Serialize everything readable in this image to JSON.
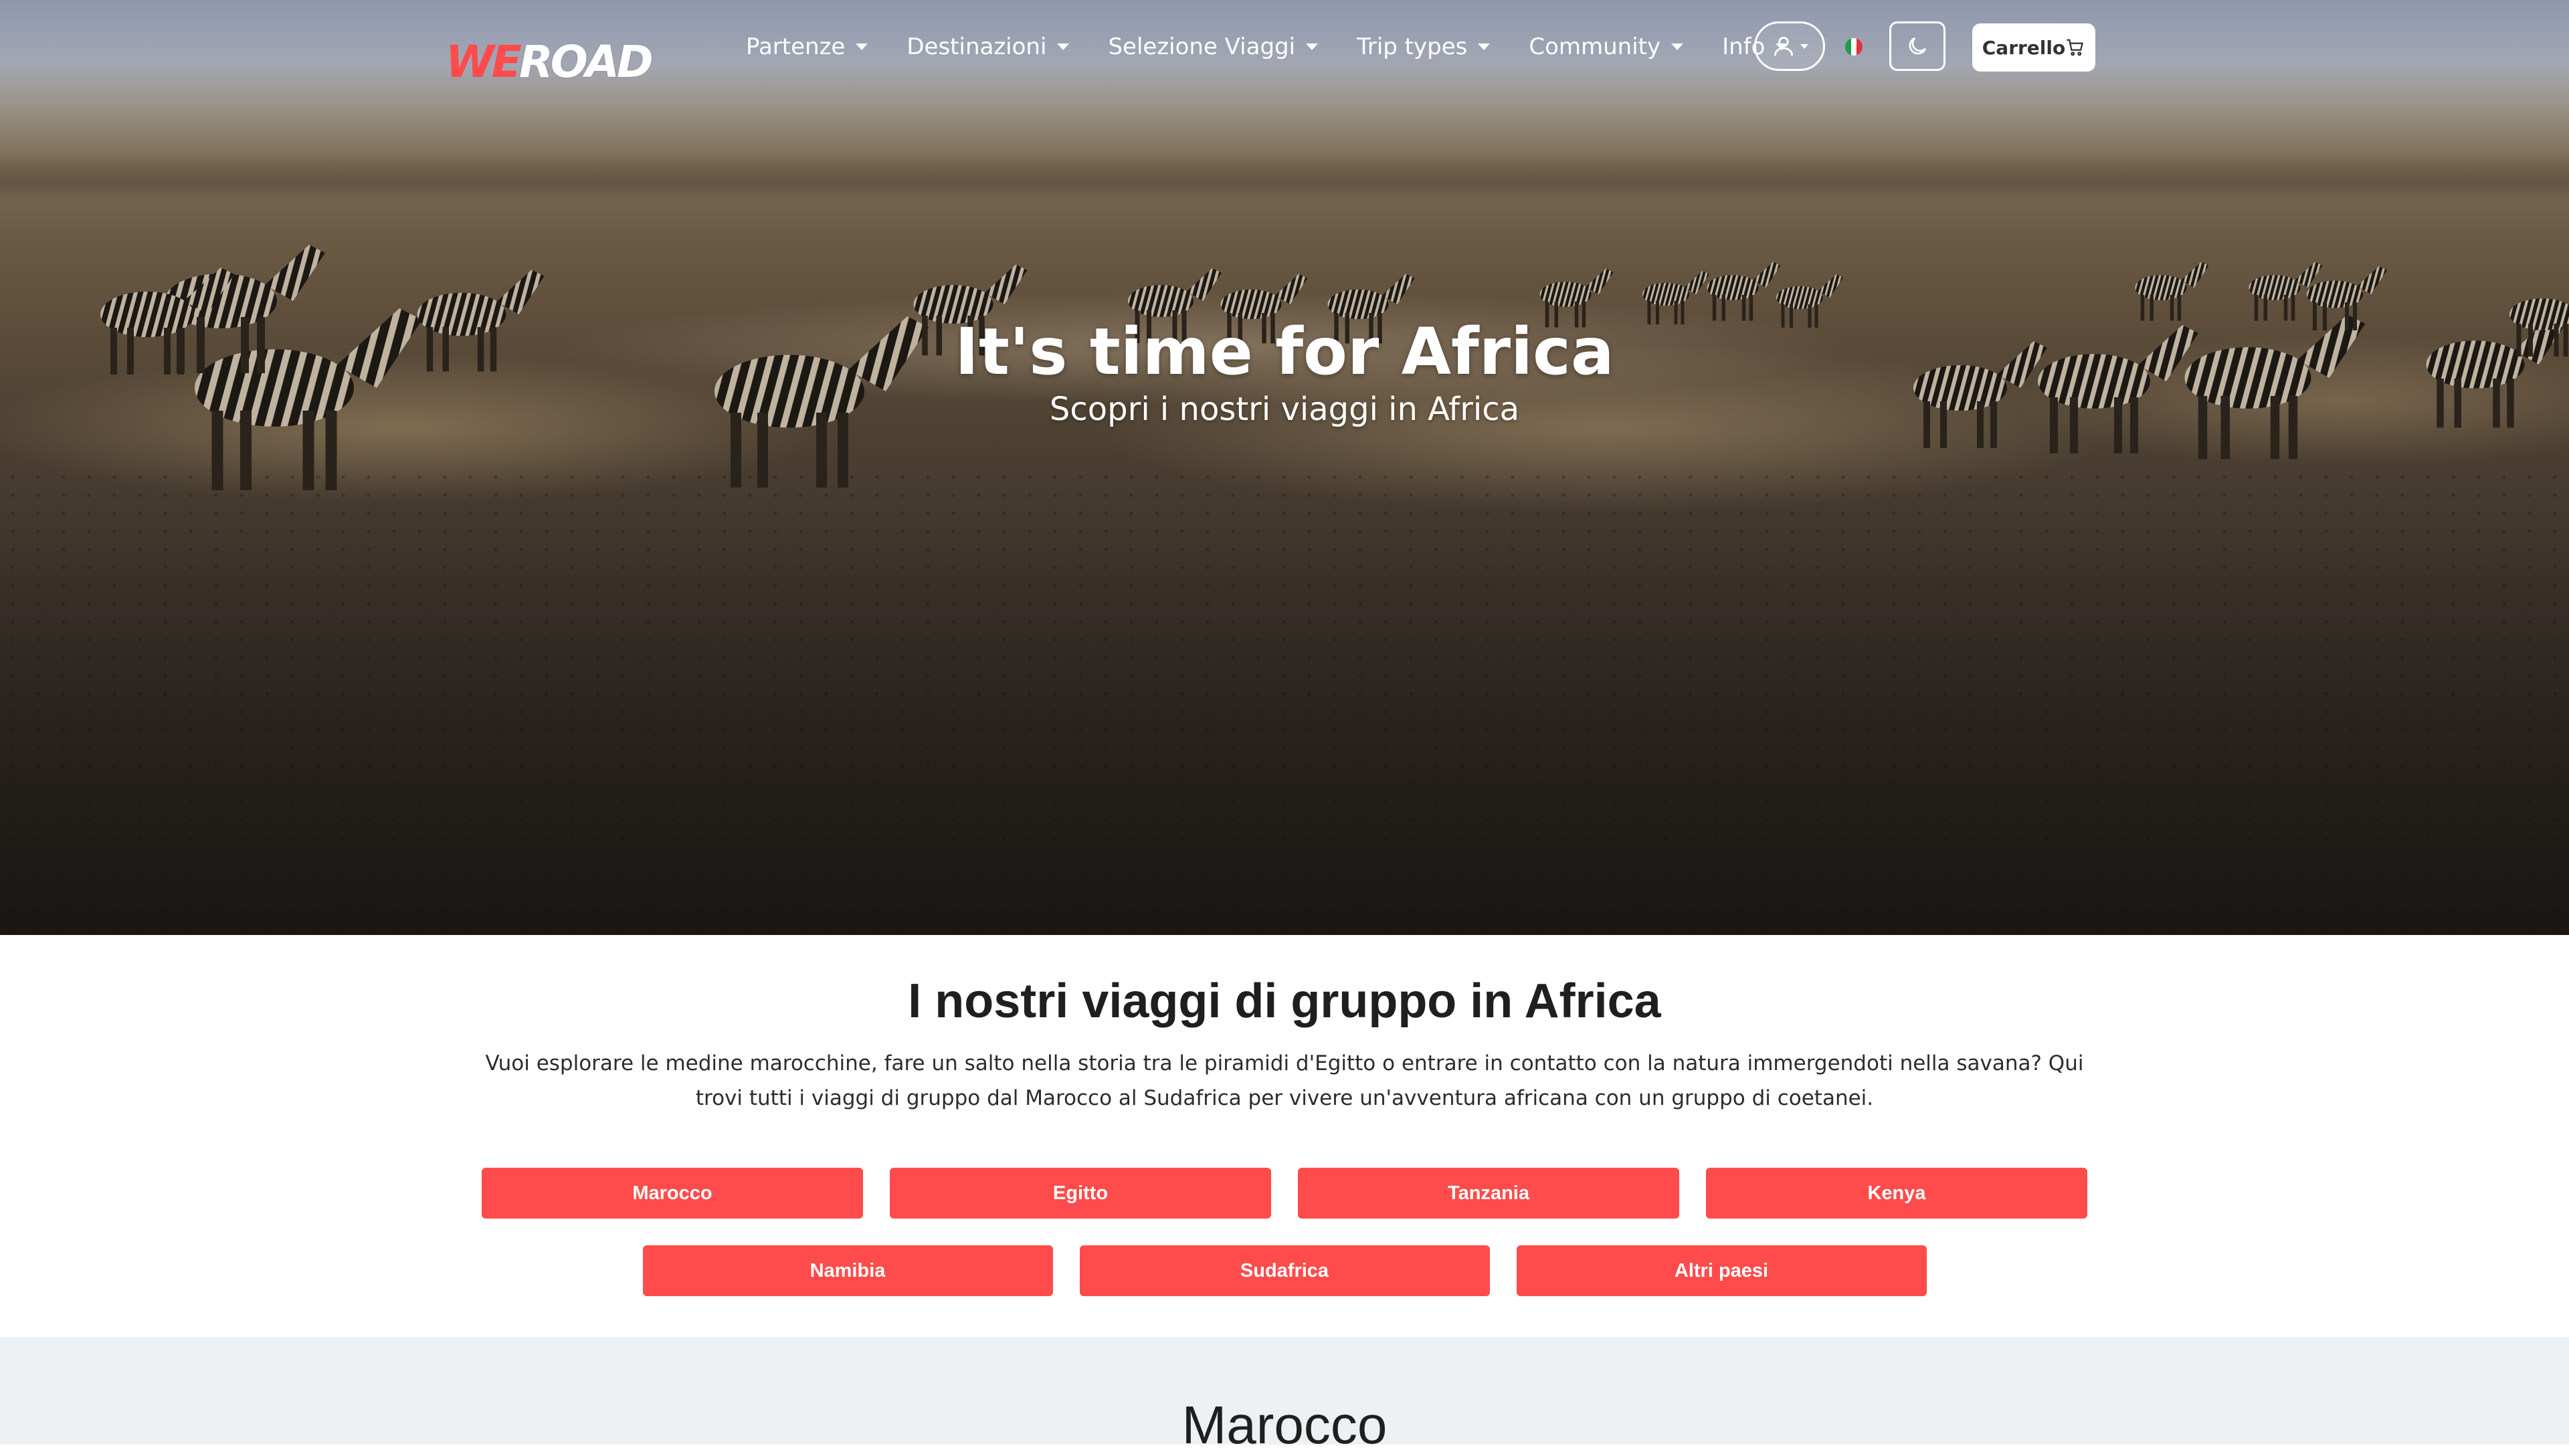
{
  "brand": {
    "logo_we": "WE",
    "logo_road": "ROAD",
    "accent": "#ff4b4b"
  },
  "nav": {
    "items": [
      {
        "label": "Partenze"
      },
      {
        "label": "Destinazioni"
      },
      {
        "label": "Selezione Viaggi"
      },
      {
        "label": "Trip types"
      },
      {
        "label": "Community"
      },
      {
        "label": "Info"
      }
    ],
    "user_icon": "user-icon",
    "flag": "italy-flag-icon",
    "theme_icon": "moon-icon",
    "cart_label": "Carrello",
    "cart_icon": "cart-icon"
  },
  "hero": {
    "title": "It's time for Africa",
    "subtitle": "Scopri i nostri viaggi in Africa"
  },
  "intro": {
    "title": "I nostri viaggi di gruppo in Africa",
    "description": "Vuoi esplorare le medine marocchine, fare un salto nella storia tra le piramidi d'Egitto o entrare in contatto con la natura immergendoti nella savana? Qui trovi tutti i viaggi di gruppo dal Marocco al Sudafrica per vivere un'avventura africana con un gruppo di coetanei.",
    "countries_row1": [
      "Marocco",
      "Egitto",
      "Tanzania",
      "Kenya"
    ],
    "countries_row2": [
      "Namibia",
      "Sudafrica",
      "Altri paesi"
    ]
  },
  "next_section": {
    "title": "Marocco"
  }
}
